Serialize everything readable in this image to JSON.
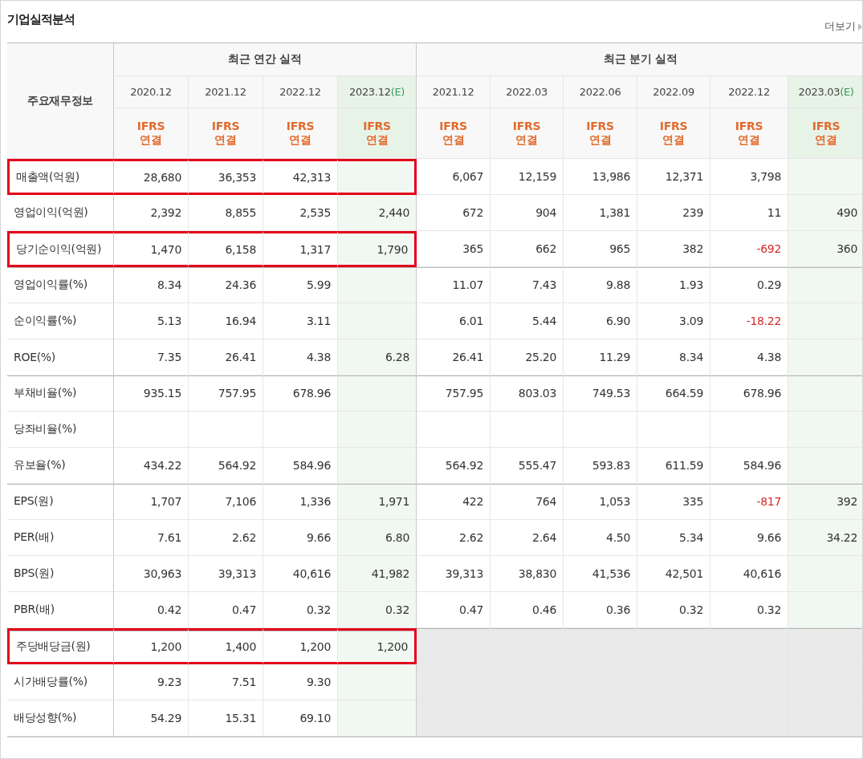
{
  "title": "기업실적분석",
  "more_link": "더보기",
  "header_label": "주요재무정보",
  "groups": [
    {
      "title": "최근 연간 실적",
      "periods": [
        {
          "label": "2020.12",
          "estimate": false,
          "basis": [
            "IFRS",
            "연결"
          ]
        },
        {
          "label": "2021.12",
          "estimate": false,
          "basis": [
            "IFRS",
            "연결"
          ]
        },
        {
          "label": "2022.12",
          "estimate": false,
          "basis": [
            "IFRS",
            "연결"
          ]
        },
        {
          "label": "2023.12",
          "mark": "(E)",
          "estimate": true,
          "basis": [
            "IFRS",
            "연결"
          ]
        }
      ]
    },
    {
      "title": "최근 분기 실적",
      "periods": [
        {
          "label": "2021.12",
          "estimate": false,
          "basis": [
            "IFRS",
            "연결"
          ]
        },
        {
          "label": "2022.03",
          "estimate": false,
          "basis": [
            "IFRS",
            "연결"
          ]
        },
        {
          "label": "2022.06",
          "estimate": false,
          "basis": [
            "IFRS",
            "연결"
          ]
        },
        {
          "label": "2022.09",
          "estimate": false,
          "basis": [
            "IFRS",
            "연결"
          ]
        },
        {
          "label": "2022.12",
          "estimate": false,
          "basis": [
            "IFRS",
            "연결"
          ]
        },
        {
          "label": "2023.03",
          "mark": "(E)",
          "estimate": true,
          "basis": [
            "IFRS",
            "연결"
          ]
        }
      ]
    }
  ],
  "rows": [
    {
      "label": "매출액(억원)",
      "highlighted": true,
      "section_start": false,
      "quarterly_available": true,
      "annual": [
        {
          "value": "28,680",
          "negative": false
        },
        {
          "value": "36,353",
          "negative": false
        },
        {
          "value": "42,313",
          "negative": false
        }
      ],
      "quarterly": [
        {
          "value": "6,067",
          "negative": false
        },
        {
          "value": "12,159",
          "negative": false
        },
        {
          "value": "13,986",
          "negative": false
        },
        {
          "value": "12,371",
          "negative": false
        },
        {
          "value": "3,798",
          "negative": false
        }
      ]
    },
    {
      "label": "영업이익(억원)",
      "highlighted": false,
      "section_start": false,
      "quarterly_available": true,
      "annual": [
        {
          "value": "2,392",
          "negative": false
        },
        {
          "value": "8,855",
          "negative": false
        },
        {
          "value": "2,535",
          "negative": false
        },
        {
          "value": "2,440",
          "negative": false
        }
      ],
      "quarterly": [
        {
          "value": "672",
          "negative": false
        },
        {
          "value": "904",
          "negative": false
        },
        {
          "value": "1,381",
          "negative": false
        },
        {
          "value": "239",
          "negative": false
        },
        {
          "value": "11",
          "negative": false
        },
        {
          "value": "490",
          "negative": false
        }
      ]
    },
    {
      "label": "당기순이익(억원)",
      "highlighted": true,
      "section_start": false,
      "quarterly_available": true,
      "annual": [
        {
          "value": "1,470",
          "negative": false
        },
        {
          "value": "6,158",
          "negative": false
        },
        {
          "value": "1,317",
          "negative": false
        },
        {
          "value": "1,790",
          "negative": false
        }
      ],
      "quarterly": [
        {
          "value": "365",
          "negative": false
        },
        {
          "value": "662",
          "negative": false
        },
        {
          "value": "965",
          "negative": false
        },
        {
          "value": "382",
          "negative": false
        },
        {
          "value": "-692",
          "negative": true
        },
        {
          "value": "360",
          "negative": false
        }
      ]
    },
    {
      "label": "영업이익률(%)",
      "highlighted": false,
      "section_start": true,
      "quarterly_available": true,
      "annual": [
        {
          "value": "8.34",
          "negative": false
        },
        {
          "value": "24.36",
          "negative": false
        },
        {
          "value": "5.99",
          "negative": false
        }
      ],
      "quarterly": [
        {
          "value": "11.07",
          "negative": false
        },
        {
          "value": "7.43",
          "negative": false
        },
        {
          "value": "9.88",
          "negative": false
        },
        {
          "value": "1.93",
          "negative": false
        },
        {
          "value": "0.29",
          "negative": false
        }
      ]
    },
    {
      "label": "순이익률(%)",
      "highlighted": false,
      "section_start": false,
      "quarterly_available": true,
      "annual": [
        {
          "value": "5.13",
          "negative": false
        },
        {
          "value": "16.94",
          "negative": false
        },
        {
          "value": "3.11",
          "negative": false
        }
      ],
      "quarterly": [
        {
          "value": "6.01",
          "negative": false
        },
        {
          "value": "5.44",
          "negative": false
        },
        {
          "value": "6.90",
          "negative": false
        },
        {
          "value": "3.09",
          "negative": false
        },
        {
          "value": "-18.22",
          "negative": true
        }
      ]
    },
    {
      "label": "ROE(%)",
      "highlighted": false,
      "section_start": false,
      "quarterly_available": true,
      "annual": [
        {
          "value": "7.35",
          "negative": false
        },
        {
          "value": "26.41",
          "negative": false
        },
        {
          "value": "4.38",
          "negative": false
        },
        {
          "value": "6.28",
          "negative": false
        }
      ],
      "quarterly": [
        {
          "value": "26.41",
          "negative": false
        },
        {
          "value": "25.20",
          "negative": false
        },
        {
          "value": "11.29",
          "negative": false
        },
        {
          "value": "8.34",
          "negative": false
        },
        {
          "value": "4.38",
          "negative": false
        }
      ]
    },
    {
      "label": "부채비율(%)",
      "highlighted": false,
      "section_start": true,
      "quarterly_available": true,
      "annual": [
        {
          "value": "935.15",
          "negative": false
        },
        {
          "value": "757.95",
          "negative": false
        },
        {
          "value": "678.96",
          "negative": false
        }
      ],
      "quarterly": [
        {
          "value": "757.95",
          "negative": false
        },
        {
          "value": "803.03",
          "negative": false
        },
        {
          "value": "749.53",
          "negative": false
        },
        {
          "value": "664.59",
          "negative": false
        },
        {
          "value": "678.96",
          "negative": false
        }
      ]
    },
    {
      "label": "당좌비율(%)",
      "highlighted": false,
      "section_start": false,
      "quarterly_available": true
    },
    {
      "label": "유보율(%)",
      "highlighted": false,
      "section_start": false,
      "quarterly_available": true,
      "annual": [
        {
          "value": "434.22",
          "negative": false
        },
        {
          "value": "564.92",
          "negative": false
        },
        {
          "value": "584.96",
          "negative": false
        }
      ],
      "quarterly": [
        {
          "value": "564.92",
          "negative": false
        },
        {
          "value": "555.47",
          "negative": false
        },
        {
          "value": "593.83",
          "negative": false
        },
        {
          "value": "611.59",
          "negative": false
        },
        {
          "value": "584.96",
          "negative": false
        }
      ]
    },
    {
      "label": "EPS(원)",
      "highlighted": false,
      "section_start": true,
      "quarterly_available": true,
      "annual": [
        {
          "value": "1,707",
          "negative": false
        },
        {
          "value": "7,106",
          "negative": false
        },
        {
          "value": "1,336",
          "negative": false
        },
        {
          "value": "1,971",
          "negative": false
        }
      ],
      "quarterly": [
        {
          "value": "422",
          "negative": false
        },
        {
          "value": "764",
          "negative": false
        },
        {
          "value": "1,053",
          "negative": false
        },
        {
          "value": "335",
          "negative": false
        },
        {
          "value": "-817",
          "negative": true
        },
        {
          "value": "392",
          "negative": false
        }
      ]
    },
    {
      "label": "PER(배)",
      "highlighted": false,
      "section_start": false,
      "quarterly_available": true,
      "annual": [
        {
          "value": "7.61",
          "negative": false
        },
        {
          "value": "2.62",
          "negative": false
        },
        {
          "value": "9.66",
          "negative": false
        },
        {
          "value": "6.80",
          "negative": false
        }
      ],
      "quarterly": [
        {
          "value": "2.62",
          "negative": false
        },
        {
          "value": "2.64",
          "negative": false
        },
        {
          "value": "4.50",
          "negative": false
        },
        {
          "value": "5.34",
          "negative": false
        },
        {
          "value": "9.66",
          "negative": false
        },
        {
          "value": "34.22",
          "negative": false
        }
      ]
    },
    {
      "label": "BPS(원)",
      "highlighted": false,
      "section_start": false,
      "quarterly_available": true,
      "annual": [
        {
          "value": "30,963",
          "negative": false
        },
        {
          "value": "39,313",
          "negative": false
        },
        {
          "value": "40,616",
          "negative": false
        },
        {
          "value": "41,982",
          "negative": false
        }
      ],
      "quarterly": [
        {
          "value": "39,313",
          "negative": false
        },
        {
          "value": "38,830",
          "negative": false
        },
        {
          "value": "41,536",
          "negative": false
        },
        {
          "value": "42,501",
          "negative": false
        },
        {
          "value": "40,616",
          "negative": false
        }
      ]
    },
    {
      "label": "PBR(배)",
      "highlighted": false,
      "section_start": false,
      "quarterly_available": true,
      "annual": [
        {
          "value": "0.42",
          "negative": false
        },
        {
          "value": "0.47",
          "negative": false
        },
        {
          "value": "0.32",
          "negative": false
        },
        {
          "value": "0.32",
          "negative": false
        }
      ],
      "quarterly": [
        {
          "value": "0.47",
          "negative": false
        },
        {
          "value": "0.46",
          "negative": false
        },
        {
          "value": "0.36",
          "negative": false
        },
        {
          "value": "0.32",
          "negative": false
        },
        {
          "value": "0.32",
          "negative": false
        }
      ]
    },
    {
      "label": "주당배당금(원)",
      "highlighted": true,
      "section_start": true,
      "quarterly_available": false,
      "annual": [
        {
          "value": "1,200",
          "negative": false
        },
        {
          "value": "1,400",
          "negative": false
        },
        {
          "value": "1,200",
          "negative": false
        },
        {
          "value": "1,200",
          "negative": false
        }
      ]
    },
    {
      "label": "시가배당률(%)",
      "highlighted": false,
      "section_start": false,
      "quarterly_available": false,
      "annual": [
        {
          "value": "9.23",
          "negative": false
        },
        {
          "value": "7.51",
          "negative": false
        },
        {
          "value": "9.30",
          "negative": false
        }
      ]
    },
    {
      "label": "배당성향(%)",
      "highlighted": false,
      "section_start": false,
      "quarterly_available": false,
      "annual": [
        {
          "value": "54.29",
          "negative": false
        },
        {
          "value": "15.31",
          "negative": false
        },
        {
          "value": "69.10",
          "negative": false
        }
      ]
    }
  ]
}
